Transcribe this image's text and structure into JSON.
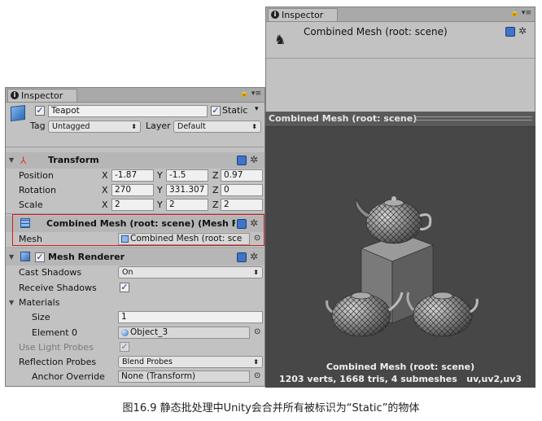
{
  "left_inspector": {
    "tab_label": "Inspector",
    "object": {
      "name": "Teapot",
      "static_label": "Static",
      "tag_label": "Tag",
      "tag_value": "Untagged",
      "layer_label": "Layer",
      "layer_value": "Default"
    },
    "transform": {
      "title": "Transform",
      "position": {
        "label": "Position",
        "x": "-1.87",
        "y": "-1.5",
        "z": "0.97"
      },
      "rotation": {
        "label": "Rotation",
        "x": "270",
        "y": "331.307",
        "z": "0"
      },
      "scale": {
        "label": "Scale",
        "x": "2",
        "y": "2",
        "z": "2"
      },
      "x_axis": "X",
      "y_axis": "Y",
      "z_axis": "Z"
    },
    "mesh_filter": {
      "title": "Combined Mesh (root: scene) (Mesh Filt",
      "mesh_label": "Mesh",
      "mesh_value": "Combined Mesh (root: sce"
    },
    "mesh_renderer": {
      "title": "Mesh Renderer",
      "cast_shadows": {
        "label": "Cast Shadows",
        "value": "On"
      },
      "receive_shadows": {
        "label": "Receive Shadows"
      },
      "materials": {
        "label": "Materials",
        "size_label": "Size",
        "size_value": "1",
        "element0_label": "Element 0",
        "element0_value": "Object_3"
      },
      "use_light_probes": {
        "label": "Use Light Probes"
      },
      "reflection_probes": {
        "label": "Reflection Probes",
        "value": "Blend Probes"
      },
      "anchor_override": {
        "label": "Anchor Override",
        "value": "None (Transform)"
      }
    }
  },
  "right_inspector": {
    "tab_label": "Inspector",
    "title": "Combined Mesh (root: scene)",
    "preview_bar_title": "Combined Mesh (root: scene)",
    "preview_name": "Combined Mesh (root: scene)",
    "preview_stats": "1203 verts, 1668 tris, 4 submeshes   uv,uv2,uv3"
  },
  "caption": "图16.9 静态批处理中Unity会合并所有被标识为“Static”的物体",
  "colors": {
    "panel": "#c2c2c2",
    "preview_bg": "#474747",
    "highlight": "#cc1f1f",
    "accent_blue": "#3f74c8"
  }
}
